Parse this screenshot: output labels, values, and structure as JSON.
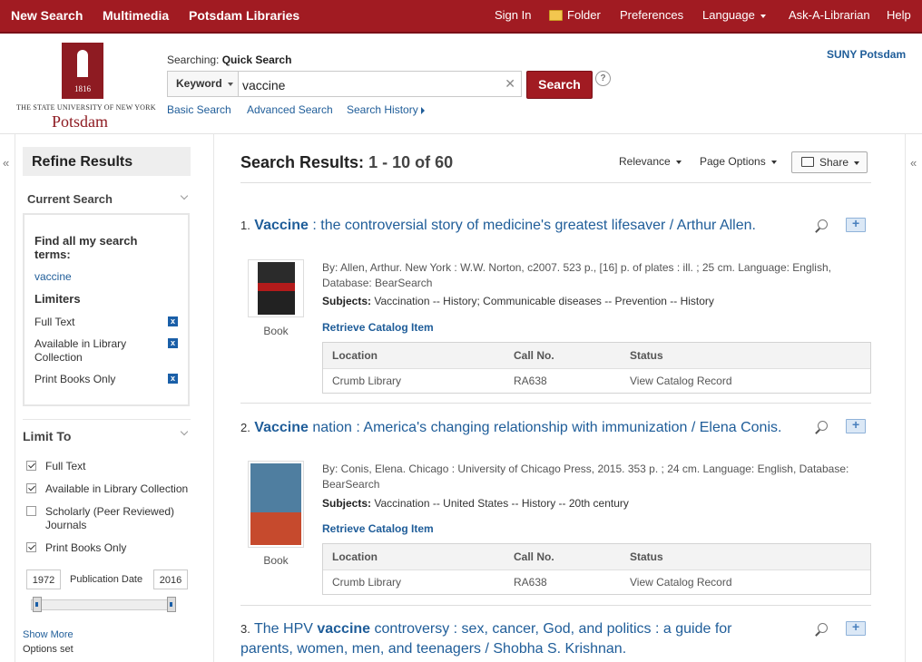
{
  "top_nav": {
    "left": [
      "New Search",
      "Multimedia",
      "Potsdam Libraries"
    ],
    "right": {
      "sign_in": "Sign In",
      "folder": "Folder",
      "preferences": "Preferences",
      "language": "Language",
      "ask": "Ask-A-Librarian",
      "help": "Help"
    }
  },
  "logo": {
    "year": "1816",
    "subtitle": "THE STATE UNIVERSITY OF NEW YORK",
    "name": "Potsdam"
  },
  "search": {
    "searching_label": "Searching:",
    "searching_value": "Quick Search",
    "field_type": "Keyword",
    "query": "vaccine",
    "button": "Search",
    "help": "?",
    "links": [
      "Basic Search",
      "Advanced Search",
      "Search History"
    ]
  },
  "institution": "SUNY Potsdam",
  "sidebar": {
    "collapse": "«",
    "refine": "Refine Results",
    "current_search": {
      "heading": "Current Search",
      "find_all_label": "Find all my search terms:",
      "term": "vaccine",
      "limiters_label": "Limiters",
      "limiters": [
        "Full Text",
        "Available in Library Collection",
        "Print Books Only"
      ]
    },
    "limit_to": {
      "heading": "Limit To",
      "options": [
        {
          "label": "Full Text",
          "checked": true
        },
        {
          "label": "Available in Library Collection",
          "checked": true
        },
        {
          "label": "Scholarly (Peer Reviewed) Journals",
          "checked": false
        },
        {
          "label": "Print Books Only",
          "checked": true
        }
      ],
      "date_from": "1972",
      "date_label": "Publication Date",
      "date_to": "2016",
      "show_more": "Show More",
      "options_set": "Options set"
    }
  },
  "results": {
    "title_label": "Search Results:",
    "title_range": "1 - 10 of 60",
    "relevance": "Relevance",
    "page_options": "Page Options",
    "share": "Share",
    "items": [
      {
        "number": "1.",
        "title_bold": "Vaccine",
        "title_rest": " : the controversial story of medicine's greatest lifesaver / Arthur Allen.",
        "type": "Book",
        "meta": "By: Allen, Arthur. New York : W.W. Norton, c2007. 523 p., [16] p. of plates : ill. ; 25 cm. Language: English, Database: BearSearch",
        "subjects_label": "Subjects:",
        "subjects": "Vaccination -- History; Communicable diseases -- Prevention -- History",
        "retrieve": "Retrieve Catalog Item",
        "holdings": {
          "location_h": "Location",
          "call_h": "Call No.",
          "status_h": "Status",
          "location": "Crumb Library",
          "call": "RA638",
          "status": "View Catalog Record"
        }
      },
      {
        "number": "2.",
        "title_bold": "Vaccine",
        "title_rest": " nation : America's changing relationship with immunization / Elena Conis.",
        "type": "Book",
        "meta": "By: Conis, Elena. Chicago : University of Chicago Press, 2015. 353 p. ; 24 cm. Language: English, Database: BearSearch",
        "subjects_label": "Subjects:",
        "subjects": "Vaccination -- United States -- History -- 20th century",
        "retrieve": "Retrieve Catalog Item",
        "holdings": {
          "location_h": "Location",
          "call_h": "Call No.",
          "status_h": "Status",
          "location": "Crumb Library",
          "call": "RA638",
          "status": "View Catalog Record"
        }
      },
      {
        "number": "3.",
        "title_pre": "The HPV ",
        "title_bold": "vaccine",
        "title_rest": " controversy : sex, cancer, God, and politics : a guide for parents, women, men, and teenagers / Shobha S. Krishnan."
      }
    ]
  },
  "colors": {
    "brand_red": "#a11b22",
    "link_blue": "#1f5d99"
  }
}
